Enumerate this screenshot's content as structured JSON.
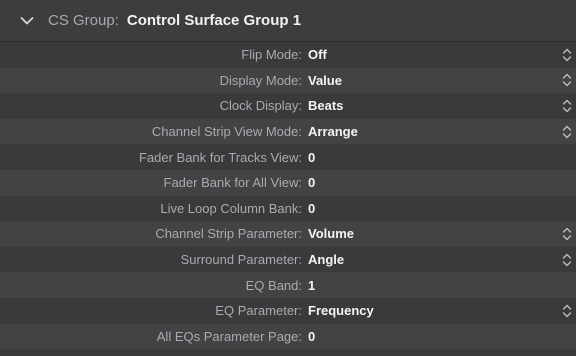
{
  "group": {
    "label": "CS Group:",
    "value": "Control Surface Group 1",
    "icon": "chevron-down-icon"
  },
  "rows": [
    {
      "label": "Flip Mode:",
      "value": "Off",
      "has_stepper": true
    },
    {
      "label": "Display Mode:",
      "value": "Value",
      "has_stepper": true
    },
    {
      "label": "Clock Display:",
      "value": "Beats",
      "has_stepper": true
    },
    {
      "label": "Channel Strip View Mode:",
      "value": "Arrange",
      "has_stepper": true
    },
    {
      "label": "Fader Bank for Tracks View:",
      "value": "0",
      "has_stepper": false
    },
    {
      "label": "Fader Bank for All View:",
      "value": "0",
      "has_stepper": false
    },
    {
      "label": "Live Loop Column Bank:",
      "value": "0",
      "has_stepper": false
    },
    {
      "label": "Channel Strip Parameter:",
      "value": "Volume",
      "has_stepper": true
    },
    {
      "label": "Surround Parameter:",
      "value": "Angle",
      "has_stepper": true
    },
    {
      "label": "EQ Band:",
      "value": "1",
      "has_stepper": false
    },
    {
      "label": "EQ Parameter:",
      "value": "Frequency",
      "has_stepper": true
    },
    {
      "label": "All EQs Parameter Page:",
      "value": "0",
      "has_stepper": false
    }
  ],
  "colors": {
    "background": "#3a3a3c",
    "alt_row": "#434345",
    "label": "#ababaf",
    "value": "#f4f4f6"
  }
}
